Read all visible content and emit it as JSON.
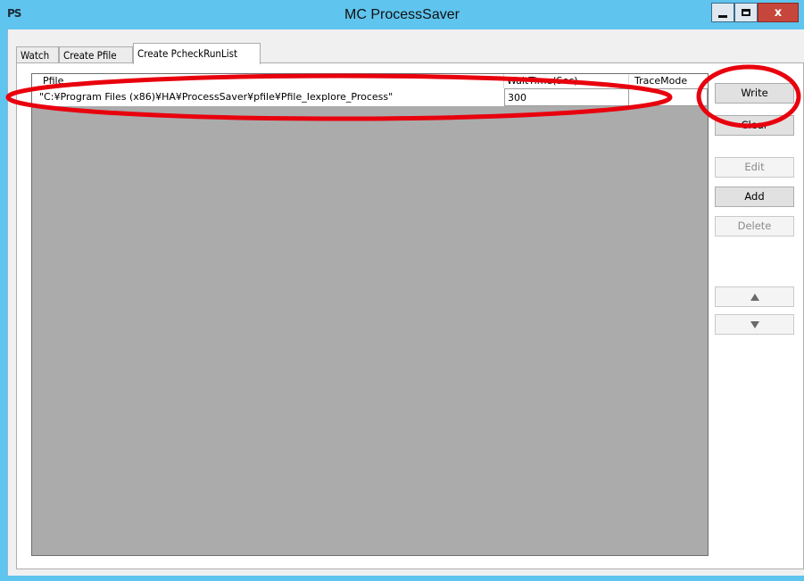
{
  "window": {
    "icon_text": "PS",
    "title": "MC ProcessSaver",
    "close_glyph": "x"
  },
  "tabs": [
    {
      "label": "Watch"
    },
    {
      "label": "Create Pfile"
    },
    {
      "label": "Create PcheckRunList"
    }
  ],
  "grid": {
    "columns": [
      "Pfile",
      "WaitTime(Sec)",
      "TraceMode"
    ],
    "rows": [
      {
        "pfile": "\"C:¥Program Files (x86)¥HA¥ProcessSaver¥pfile¥Pfile_Iexplore_Process\"",
        "wait_time": "300",
        "trace_mode": ""
      }
    ]
  },
  "buttons": {
    "write": "Write",
    "clear": "Clear",
    "edit": "Edit",
    "add": "Add",
    "delete": "Delete"
  },
  "icons": {
    "up": "triangle-up-icon",
    "down": "triangle-down-icon"
  },
  "colors": {
    "titlebar": "#5fc4ee",
    "annotation": "#e8000d",
    "grid_background": "#ababab"
  }
}
